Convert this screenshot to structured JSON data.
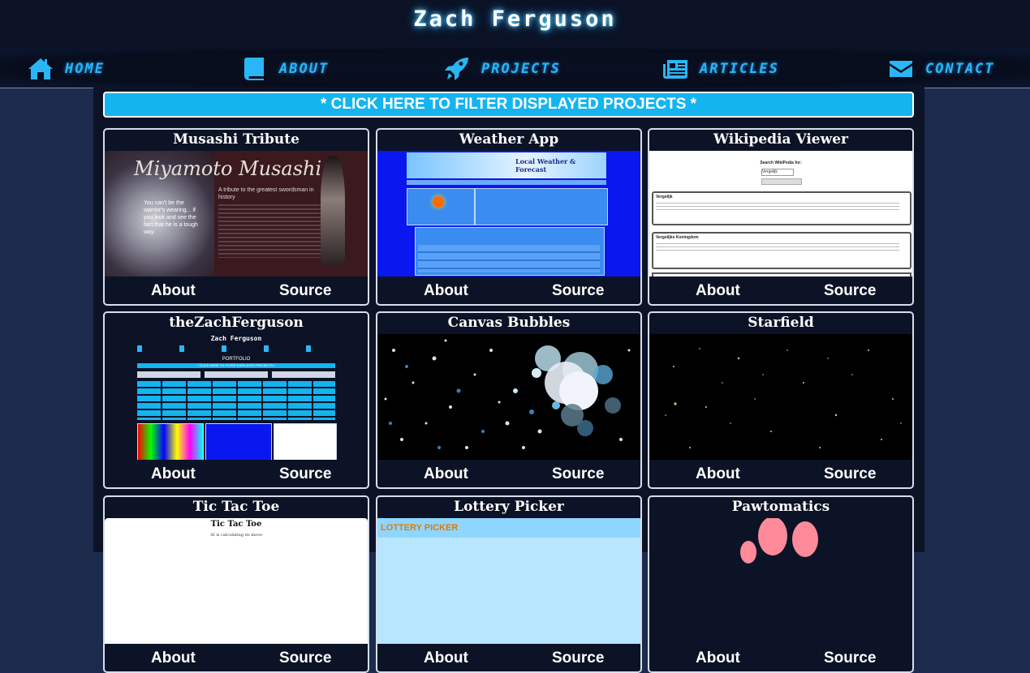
{
  "header": {
    "title": "Zach Ferguson",
    "nav": [
      {
        "label": "HOME",
        "icon": "home-icon"
      },
      {
        "label": "ABOUT",
        "icon": "book-icon"
      },
      {
        "label": "PROJECTS",
        "icon": "rocket-icon"
      },
      {
        "label": "ARTICLES",
        "icon": "newspaper-icon"
      },
      {
        "label": "CONTACT",
        "icon": "envelope-icon"
      }
    ]
  },
  "filter": {
    "label": "* CLICK HERE TO FILTER DISPLAYED PROJECTS *"
  },
  "projects": [
    {
      "title": "Musashi Tribute",
      "about": "About",
      "source": "Source",
      "thumb_text": {
        "heading": "Miyamoto Musashi",
        "tagline": "A tribute to the greatest swordsman in history",
        "quote": "You can't be the warrior's wearing... if you look and see the fact that he is a tough way."
      }
    },
    {
      "title": "Weather App",
      "about": "About",
      "source": "Source",
      "thumb_text": {
        "heading": "Local Weather & Forecast"
      }
    },
    {
      "title": "Wikipedia Viewer",
      "about": "About",
      "source": "Source",
      "thumb_text": {
        "search": "Search WikiPedia for:",
        "input": "Vergelijk",
        "result1": "Vergelijk",
        "result2": "Vergelijke Koningdom"
      }
    },
    {
      "title": "theZachFerguson",
      "about": "About",
      "source": "Source",
      "thumb_text": {
        "title": "Zach Ferguson",
        "portfolio": "PORTFOLIO",
        "filter": "* CLICK HERE TO FILTER DISPLAYED PROJECTS *"
      }
    },
    {
      "title": "Canvas Bubbles",
      "about": "About",
      "source": "Source"
    },
    {
      "title": "Starfield",
      "about": "About",
      "source": "Source"
    },
    {
      "title": "Tic Tac Toe",
      "about": "About",
      "source": "Source",
      "thumb_text": {
        "heading": "Tic Tac Toe",
        "status": "AI is calculating its move"
      }
    },
    {
      "title": "Lottery Picker",
      "about": "About",
      "source": "Source",
      "thumb_text": {
        "heading": "LOTTERY PICKER"
      }
    },
    {
      "title": "Pawtomatics",
      "about": "About",
      "source": "Source"
    }
  ],
  "colors": {
    "accent": "#29b6f6",
    "filter_bg": "#14b4ef",
    "page_bg": "#1c2b4c",
    "panel_bg": "#0c1326"
  }
}
